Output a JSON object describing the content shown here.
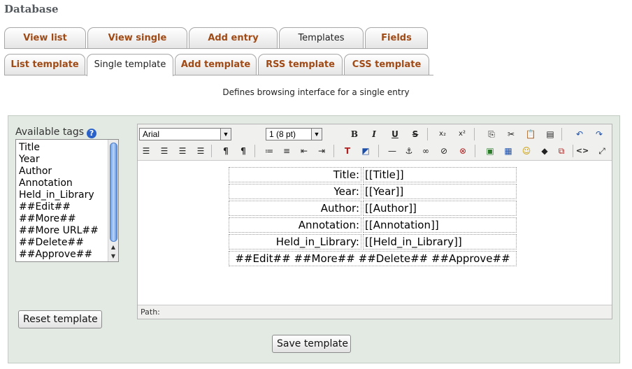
{
  "page": {
    "heading": "Database",
    "description": "Defines browsing interface for a single entry"
  },
  "main_tabs": [
    {
      "label": "View list"
    },
    {
      "label": "View single"
    },
    {
      "label": "Add entry"
    },
    {
      "label": "Templates"
    },
    {
      "label": "Fields"
    }
  ],
  "template_tabs": [
    {
      "label": "List template"
    },
    {
      "label": "Single template"
    },
    {
      "label": "Add template"
    },
    {
      "label": "RSS template"
    },
    {
      "label": "CSS template"
    }
  ],
  "available_tags": {
    "label": "Available tags",
    "help_icon": "?",
    "items": [
      "Title",
      "Year",
      "Author",
      "Annotation",
      "Held_in_Library",
      "##Edit##",
      "##More##",
      "##More URL##",
      "##Delete##",
      "##Approve##"
    ]
  },
  "buttons": {
    "reset": "Reset template",
    "save": "Save template"
  },
  "editor": {
    "font_family": "Arial",
    "font_size": "1 (8 pt)",
    "path_label": "Path:",
    "template_rows": [
      {
        "label": "Title:",
        "value": "[[Title]]"
      },
      {
        "label": "Year:",
        "value": "[[Year]]"
      },
      {
        "label": "Author:",
        "value": "[[Author]]"
      },
      {
        "label": "Annotation:",
        "value": "[[Annotation]]"
      },
      {
        "label": "Held_in_Library:",
        "value": "[[Held_in_Library]]"
      }
    ],
    "actions_row": "##Edit## ##More## ##Delete## ##Approve##"
  },
  "toolbar_icons": {
    "bold": "B",
    "italic": "I",
    "underline": "U",
    "strike": "S",
    "subscript": "x₂",
    "superscript": "x²",
    "undo": "↶",
    "redo": "↷",
    "ltr": "¶",
    "rtl": "¶",
    "anchor": "⚓",
    "html": "<>"
  }
}
